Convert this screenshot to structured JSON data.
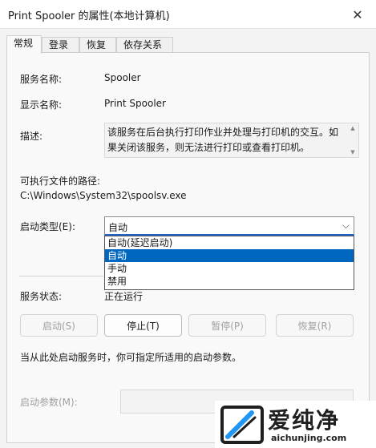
{
  "window": {
    "title": "Print Spooler 的属性(本地计算机)",
    "close_glyph": "✕"
  },
  "tabs": [
    {
      "label": "常规",
      "active": true
    },
    {
      "label": "登录",
      "active": false
    },
    {
      "label": "恢复",
      "active": false
    },
    {
      "label": "依存关系",
      "active": false
    }
  ],
  "general": {
    "service_name_label": "服务名称:",
    "service_name_value": "Spooler",
    "display_name_label": "显示名称:",
    "display_name_value": "Print Spooler",
    "description_label": "描述:",
    "description_value": "该服务在后台执行打印作业并处理与打印机的交互。如果关闭该服务，则无法进行打印或查看打印机。",
    "exe_path_label": "可执行文件的路径:",
    "exe_path_value": "C:\\Windows\\System32\\spoolsv.exe",
    "startup_type_label": "启动类型(E):",
    "startup_type_value": "自动",
    "startup_type_options": [
      {
        "label": "自动(延迟启动)",
        "selected": false
      },
      {
        "label": "自动",
        "selected": true
      },
      {
        "label": "手动",
        "selected": false
      },
      {
        "label": "禁用",
        "selected": false
      }
    ],
    "service_status_label": "服务状态:",
    "service_status_value": "正在运行",
    "buttons": {
      "start": {
        "label": "启动(S)",
        "enabled": false
      },
      "stop": {
        "label": "停止(T)",
        "enabled": true
      },
      "pause": {
        "label": "暂停(P)",
        "enabled": false
      },
      "resume": {
        "label": "恢复(R)",
        "enabled": false
      }
    },
    "hint": "当从此处启动服务时，你可指定所适用的启动参数。",
    "start_params_label": "启动参数(M):",
    "start_params_value": ""
  },
  "watermark": {
    "name": "爱纯净",
    "url": "aichunjing.com"
  },
  "colors": {
    "accent": "#0067c0",
    "combo_focus": "#1f63c9"
  }
}
